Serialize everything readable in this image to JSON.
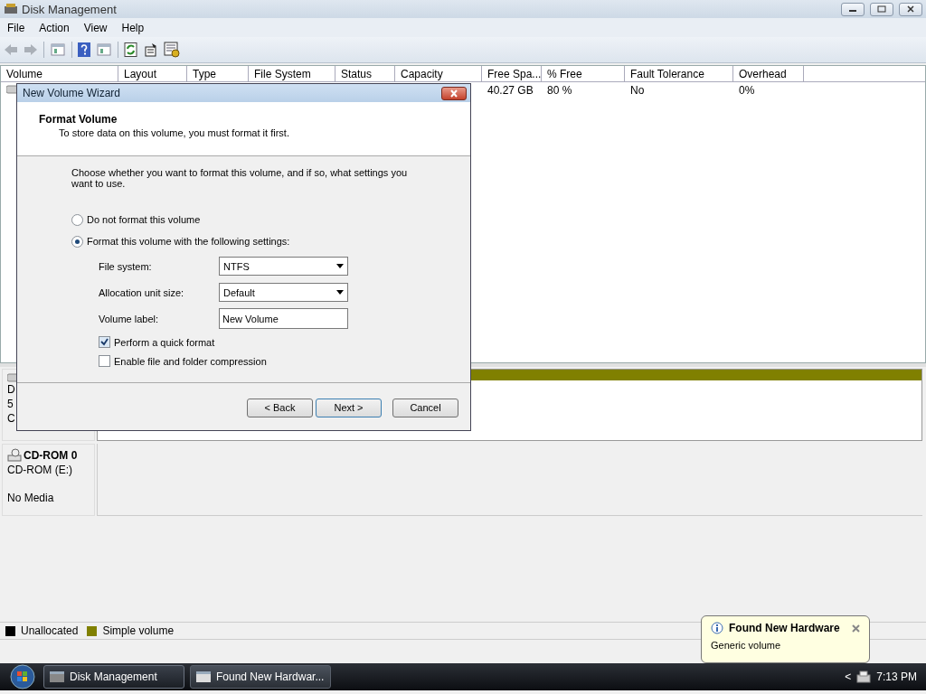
{
  "window": {
    "title": "Disk Management"
  },
  "menu": [
    "File",
    "Action",
    "View",
    "Help"
  ],
  "table": {
    "columns": [
      "Volume",
      "Layout",
      "Type",
      "File System",
      "Status",
      "Capacity",
      "Free Spa...",
      "% Free",
      "Fault Tolerance",
      "Overhead"
    ],
    "rows": [
      {
        "cells": [
          null,
          null,
          null,
          null,
          null,
          null,
          "40.27 GB",
          "80 %",
          "No",
          "0%"
        ]
      }
    ]
  },
  "disks": [
    {
      "kind": "disk",
      "label_lines": [
        "D",
        "5",
        "C"
      ],
      "color": "#808000"
    },
    {
      "kind": "cdrom",
      "name": "CD-ROM 0",
      "label_lines": [
        "CD-ROM (E:)",
        "No Media"
      ]
    }
  ],
  "legend": [
    {
      "label": "Unallocated",
      "color": "#000000"
    },
    {
      "label": "Simple volume",
      "color": "#808000"
    }
  ],
  "dialog": {
    "title": "New Volume Wizard",
    "heading": "Format Volume",
    "subheading": "To store data on this volume, you must format it first.",
    "instruction": "Choose whether you want to format this volume, and if so, what settings you want to use.",
    "options": [
      {
        "label": "Do not format this volume",
        "selected": false
      },
      {
        "label": "Format this volume with the following settings:",
        "selected": true
      }
    ],
    "fields": [
      {
        "kind": "select",
        "label": "File system:",
        "value": "NTFS"
      },
      {
        "kind": "select",
        "label": "Allocation unit size:",
        "value": "Default"
      },
      {
        "kind": "text",
        "label": "Volume label:",
        "value": "New Volume"
      }
    ],
    "checkboxes": [
      {
        "label": "Perform a quick format",
        "checked": true
      },
      {
        "label": "Enable file and folder compression",
        "checked": false
      }
    ],
    "buttons": [
      "< Back",
      "Next >",
      "Cancel"
    ]
  },
  "notification": {
    "title": "Found New Hardware",
    "message": "Generic volume"
  },
  "taskbar": {
    "items": [
      {
        "label": "Disk Management",
        "selected": true
      },
      {
        "label": "Found New Hardwar...",
        "selected": false
      }
    ],
    "tray_arrow": "<",
    "time": "7:13 PM"
  }
}
